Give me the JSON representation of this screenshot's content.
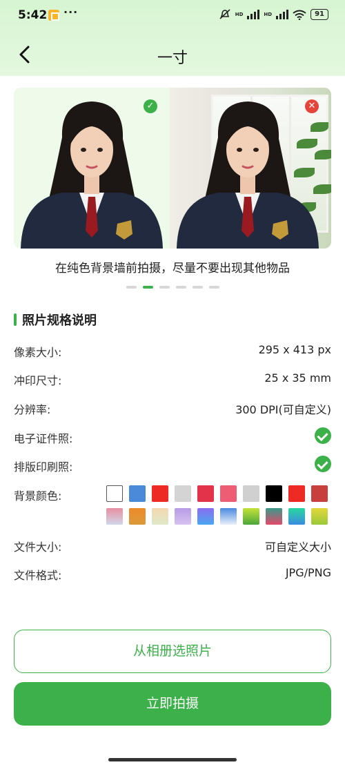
{
  "status_bar": {
    "time": "5:42",
    "more": "···",
    "signal_label_1": "HD",
    "signal_label_2": "HD",
    "battery": "91"
  },
  "nav": {
    "title": "一寸"
  },
  "gallery": {
    "caption": "在纯色背景墙前拍摄，尽量不要出现其他物品",
    "page_count": 6,
    "active_page": 2
  },
  "specs": {
    "section_title": "照片规格说明",
    "pixel_size_label": "像素大小:",
    "pixel_size_value": "295 x 413 px",
    "print_size_label": "冲印尺寸:",
    "print_size_value": "25 x 35 mm",
    "resolution_label": "分辨率:",
    "resolution_value": "300 DPI(可自定义)",
    "digital_label": "电子证件照:",
    "layout_print_label": "排版印刷照:",
    "bg_color_label": "背景颜色:",
    "file_size_label": "文件大小:",
    "file_size_value": "可自定义大小",
    "file_format_label": "文件格式:",
    "file_format_value": "JPG/PNG"
  },
  "background_colors": [
    "#ffffff",
    "#4a8ad8",
    "#ee2a24",
    "#d4d4d4",
    "#e2334a",
    "#ee5d73",
    "#d0d0d0",
    "#000000",
    "#ee2a24",
    "#c8403e",
    "linear-gradient(#e98ea2,#d0d8ea)",
    "linear-gradient(#ee8a2a,#d99a3a)",
    "linear-gradient(#f3d8b0,#dfe9c8)",
    "linear-gradient(#b79ce6,#d7c2ef)",
    "linear-gradient(#8a6ef0,#4aa7f0)",
    "linear-gradient(#4a8ae0,#e8eefa)",
    "linear-gradient(#c6e23a,#4aa63a)",
    "linear-gradient(#3a9a8a,#e24a6a)",
    "linear-gradient(#2ad8a0,#3a8ae0)",
    "linear-gradient(#e2d83a,#9ac83a)"
  ],
  "buttons": {
    "album": "从相册选照片",
    "shoot": "立即拍摄"
  },
  "colors": {
    "accent": "#3cb14a",
    "header_bg": "#d7f5d2",
    "error": "#e5443b"
  }
}
